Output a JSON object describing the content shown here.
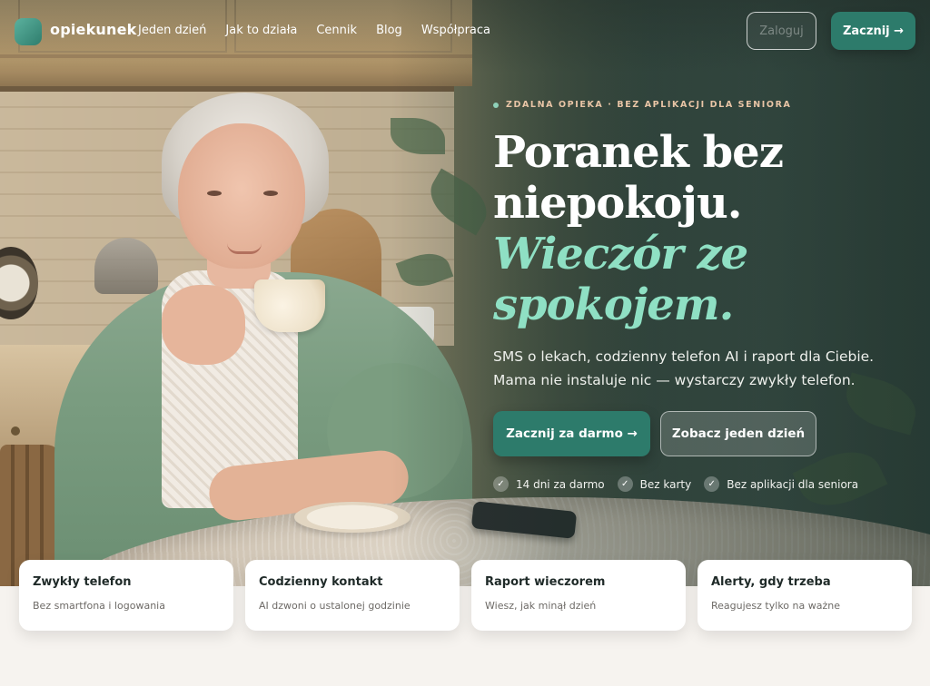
{
  "brand": {
    "name": "opiekunek",
    "logo_color": "#3f9a86"
  },
  "nav": {
    "links": [
      "Jeden dzień",
      "Jak to działa",
      "Cennik",
      "Blog",
      "Współpraca"
    ],
    "login_label": "Zaloguj",
    "start_label": "Zacznij →"
  },
  "hero": {
    "eyebrow": "Zdalna opieka · bez aplikacji dla seniora",
    "headline_line1": "Poranek bez",
    "headline_line2": "niepokoju.",
    "headline_accent1": "Wieczór ze",
    "headline_accent2": "spokojem.",
    "lede_line1": "SMS o lekach, codzienny telefon AI i raport dla Ciebie.",
    "lede_line2": "Mama nie instaluje nic — wystarczy zwykły telefon.",
    "cta_primary": "Zacznij za darmo →",
    "cta_secondary": "Zobacz jeden dzień",
    "checks": [
      "14 dni za darmo",
      "Bez karty",
      "Bez aplikacji dla seniora"
    ]
  },
  "features": [
    {
      "title": "Zwykły telefon",
      "desc": "Bez smartfona i logowania"
    },
    {
      "title": "Codzienny kontakt",
      "desc": "AI dzwoni o ustalonej godzinie"
    },
    {
      "title": "Raport wieczorem",
      "desc": "Wiesz, jak minął dzień"
    },
    {
      "title": "Alerty, gdy trzeba",
      "desc": "Reagujesz tylko na ważne"
    }
  ],
  "colors": {
    "primary": "#2d7b6b",
    "accent_text": "#8fe0c4",
    "eyebrow": "#e9c5a6"
  }
}
